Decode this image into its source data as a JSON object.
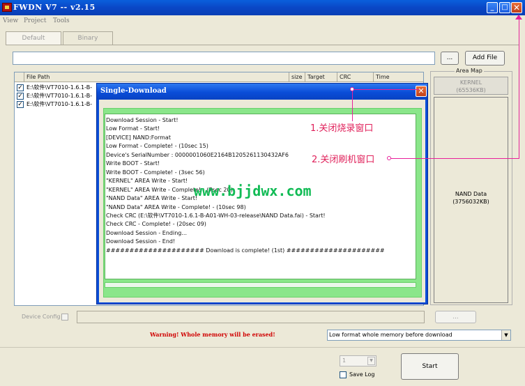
{
  "window": {
    "title": "FWDN V7 -- v2.15",
    "controls": {
      "minimize": "_",
      "maximize": "□",
      "close": "✕"
    }
  },
  "menu": [
    "View",
    "Project",
    "Tools"
  ],
  "tabs": [
    "Default",
    "Binary"
  ],
  "toolbar": {
    "path_value": "",
    "browse_label": "...",
    "add_file_label": "Add File"
  },
  "file_list": {
    "columns": [
      "File Path",
      "size",
      "Target",
      "CRC",
      "Time"
    ],
    "rows": [
      {
        "checked": true,
        "path": "E:\\软件\\VT7010-1.6.1-B-"
      },
      {
        "checked": true,
        "path": "E:\\软件\\VT7010-1.6.1-B-"
      },
      {
        "checked": true,
        "path": "E:\\软件\\VT7010-1.6.1-B-"
      }
    ]
  },
  "area_map": {
    "title": "Area Map",
    "kernel": {
      "name": "KERNEL",
      "size": "(65536KB)"
    },
    "nand": {
      "name": "NAND Data",
      "size": "(3756032KB)"
    }
  },
  "device_config": {
    "label": "Device Config",
    "button": "..."
  },
  "warning": "Warning! Whole memory will be erased!",
  "format_select": {
    "value": "Low format whole memory before download",
    "arrow": "▼"
  },
  "bottom": {
    "count_value": "1",
    "count_arrow": "▼",
    "save_log_label": "Save Log",
    "start_label": "Start"
  },
  "dialog": {
    "title": "Single-Download",
    "close": "✕",
    "log_lines": [
      "Download Session - Start!",
      "Low Format - Start!",
      "[DEVICE] NAND:Format",
      "Low Format - Complete! - (10sec 15)",
      "Device's SerialNumber : 0000001060E2164B1205261130432AF6",
      "Write BOOT - Start!",
      "Write BOOT - Complete! - (3sec 56)",
      "\"KERNEL\" AREA Write - Start!",
      "\"KERNEL\" AREA Write - Complete! - (7sec 20)",
      "\"NAND Data\" AREA Write - Start!",
      "\"NAND Data\" AREA Write - Complete! - (10sec 98)",
      "Check CRC (E:\\软件\\VT7010-1.6.1-B-A01-WH-03-release\\NAND Data.fai) - Start!",
      "Check CRC - Complete! - (20sec 09)",
      "Download Session - Ending...",
      "Download Session - End!",
      "#####################   Download is complete! (1st)   #####################"
    ]
  },
  "annotations": {
    "watermark": "www.bjjdwx.com",
    "note_1": "1.关闭烧录窗口",
    "note_2": "2.关闭刷机窗口",
    "color": "#e0205a"
  }
}
